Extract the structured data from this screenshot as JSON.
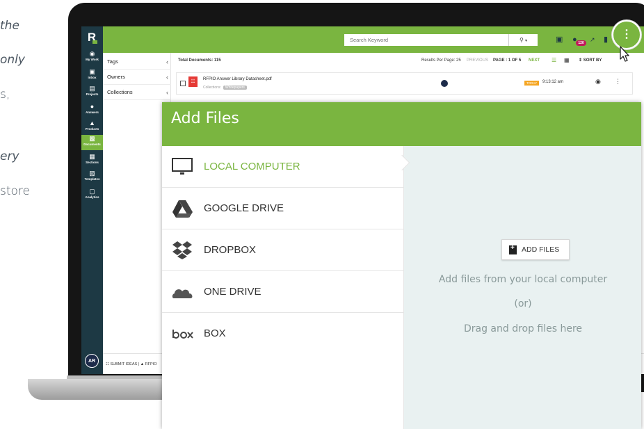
{
  "background_copy": {
    "lines": [
      "the",
      "only",
      "s,",
      "ery",
      "store"
    ]
  },
  "app": {
    "logo_letter": "R",
    "search": {
      "placeholder": "Search Keyword"
    },
    "notification_count": "120",
    "sidebar": {
      "items": [
        {
          "label": "My Work",
          "icon": "dashboard-icon"
        },
        {
          "label": "Inbox",
          "icon": "inbox-icon"
        },
        {
          "label": "Projects",
          "icon": "projects-icon"
        },
        {
          "label": "Answers",
          "icon": "answers-icon"
        },
        {
          "label": "Products",
          "icon": "products-icon"
        },
        {
          "label": "Documents",
          "icon": "documents-icon",
          "active": true
        },
        {
          "label": "Sections",
          "icon": "sections-icon"
        },
        {
          "label": "Templates",
          "icon": "templates-icon"
        },
        {
          "label": "Analytics",
          "icon": "analytics-icon"
        }
      ],
      "avatar_initials": "AR"
    },
    "filters": [
      "Tags",
      "Owners",
      "Collections"
    ],
    "list_header": {
      "total": "Total Documents: 115",
      "per_page": "Results Per Page: 25",
      "previous": "PREVIOUS",
      "page": "PAGE : 1 OF 5",
      "next": "NEXT",
      "sort": "SORT BY"
    },
    "document": {
      "title": "RFPIO Answer Library Datasheet.pdf",
      "collections_label": "Collections:",
      "collection_tag": "Whitepapers",
      "date_badge": "TODAY",
      "time": "9:13:12 am"
    },
    "bottom_bar": {
      "submit_ideas": "SUBMIT IDEAS",
      "separator": "|",
      "rfpio": "RFPIO"
    }
  },
  "modal": {
    "title": "Add Files",
    "sources": [
      {
        "label": "LOCAL COMPUTER",
        "icon": "monitor-icon",
        "active": true
      },
      {
        "label": "GOOGLE DRIVE",
        "icon": "google-drive-icon",
        "active": false
      },
      {
        "label": "DROPBOX",
        "icon": "dropbox-icon",
        "active": false
      },
      {
        "label": "ONE DRIVE",
        "icon": "one-drive-icon",
        "active": false
      },
      {
        "label": "BOX",
        "icon": "box-logo-icon",
        "active": false
      }
    ],
    "add_files_button": "ADD FILES",
    "drop_text": {
      "line1": "Add files from your local computer",
      "line2": "(or)",
      "line3": "Drag and drop files here"
    }
  },
  "colors": {
    "accent_green": "#7ab540",
    "sidebar_navy": "#1d3944",
    "drop_area": "#e9f1f1",
    "badge_magenta": "#c2185b",
    "pdf_red": "#e53935"
  }
}
